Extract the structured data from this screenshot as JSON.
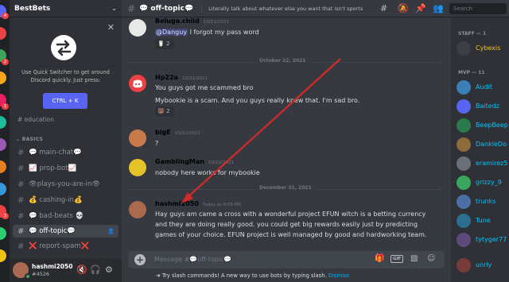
{
  "server": {
    "name": "BestBets"
  },
  "quick_switcher": {
    "text": "Use Quick Switcher to get around Discord quickly. Just press:",
    "shortcut": "CTRL + K"
  },
  "sidebar": {
    "partial_channel": "education",
    "category": "BASICS",
    "channels": [
      {
        "label": "💬 main-chat💬",
        "active": false
      },
      {
        "label": "📈 prop-bot📈",
        "active": false
      },
      {
        "label": "👁plays-you-are-in👁",
        "active": false
      },
      {
        "label": "💰 cashing-in💰",
        "active": false
      },
      {
        "label": "💬 bad-beats 💀",
        "active": false
      },
      {
        "label": "💬 off-topic💬",
        "active": true
      },
      {
        "label": "❌ report-spam❌",
        "active": false
      }
    ]
  },
  "user": {
    "name": "hashmi2050",
    "tag": "#4526"
  },
  "channel": {
    "name": "💬 off-topic💬",
    "topic": "Literally talk about whatever else you want that isn't sports"
  },
  "search": {
    "placeholder": "Search"
  },
  "messages": [
    {
      "author": "Beluga.child",
      "author_color": "#3ba55d",
      "timestamp": "10/11/2021",
      "lines": [
        "I forgot my pass word"
      ],
      "mention": "@Danguy",
      "reaction": {
        "emoji": "🥛",
        "count": "2"
      }
    },
    {
      "author": "Hp22a",
      "author_color": "#3ba55d",
      "timestamp": "10/22/2021",
      "lines": [
        "You guys got me scammed bro",
        "Mybookie is a scam. And you guys really knew that. I'm sad bro."
      ],
      "reaction": {
        "emoji": "🐻",
        "count": "2"
      }
    },
    {
      "author": "bigE",
      "author_color": "#9b59b6",
      "timestamp": "10/22/2021",
      "lines": [
        "?"
      ]
    },
    {
      "author": "GamblingMan",
      "author_color": "#3ba55d",
      "timestamp": "10/22/2021",
      "lines": [
        "nobody here works for mybookie"
      ]
    },
    {
      "author": "hashmi2050",
      "author_color": "#3ba55d",
      "timestamp": "Today at 9:59 PM",
      "lines": [
        "Hay guys am came a cross with a wonderful project  EFUN witch is a betting currency",
        "and they are doing really good. you could get big rewards easily just by predicting",
        "games of your choice. EFUN  project is well managed by good and hardworking team."
      ]
    }
  ],
  "dividers": [
    "October 22, 2021",
    "December 31, 2021"
  ],
  "composer": {
    "placeholder": "Message #💬off-topic💬",
    "gif_label": "GIF"
  },
  "slash_tip": {
    "text": "Try slash commands! A new way to use bots by typing slash.",
    "dismiss": "Dismiss"
  },
  "members": {
    "staff_label": "STAFF — 1",
    "staff": [
      {
        "name": "Cybexis",
        "color": "#f1c40f"
      }
    ],
    "mvp_label": "MVP — 11",
    "mvp": [
      {
        "name": "Audit",
        "color": "#00c5ff"
      },
      {
        "name": "Baitedz",
        "color": "#00c5ff"
      },
      {
        "name": "BeepBeep",
        "color": "#00c5ff"
      },
      {
        "name": "DankleDo",
        "color": "#00c5ff"
      },
      {
        "name": "eramirez5",
        "color": "#00c5ff"
      },
      {
        "name": "grizzy_9",
        "color": "#00c5ff"
      },
      {
        "name": "trunks",
        "color": "#00c5ff"
      },
      {
        "name": "Tune",
        "color": "#00c5ff"
      },
      {
        "name": "tytyger77",
        "color": "#00c5ff"
      },
      {
        "name": "unrly",
        "color": "#00c5ff"
      }
    ]
  },
  "colors": {
    "accent": "#5865f2",
    "annotation_arrow": "#d42a2a",
    "online": "#3ba55d"
  }
}
